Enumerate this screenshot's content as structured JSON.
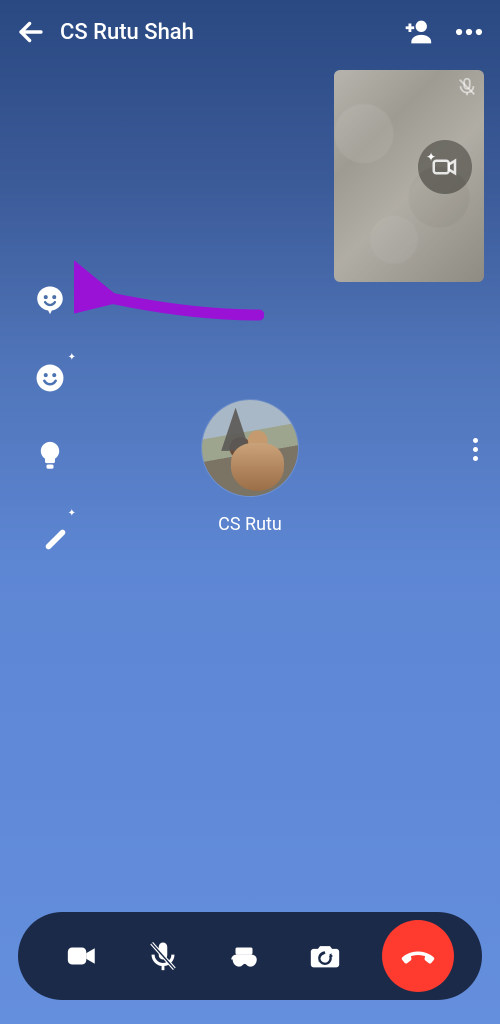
{
  "header": {
    "title": "CS Rutu Shah"
  },
  "participant": {
    "display_name": "CS Rutu"
  },
  "side_tools": {
    "avatar_effect": "avatar-effect",
    "reaction": "reaction-emoji",
    "lighting": "lighting",
    "touchup": "magic-wand"
  },
  "bottom_bar": {
    "video": "video-toggle",
    "mic": "mic-muted",
    "games": "games",
    "flip": "flip-camera",
    "end": "end-call"
  },
  "pip": {
    "muted": true,
    "camera_effects": true
  }
}
